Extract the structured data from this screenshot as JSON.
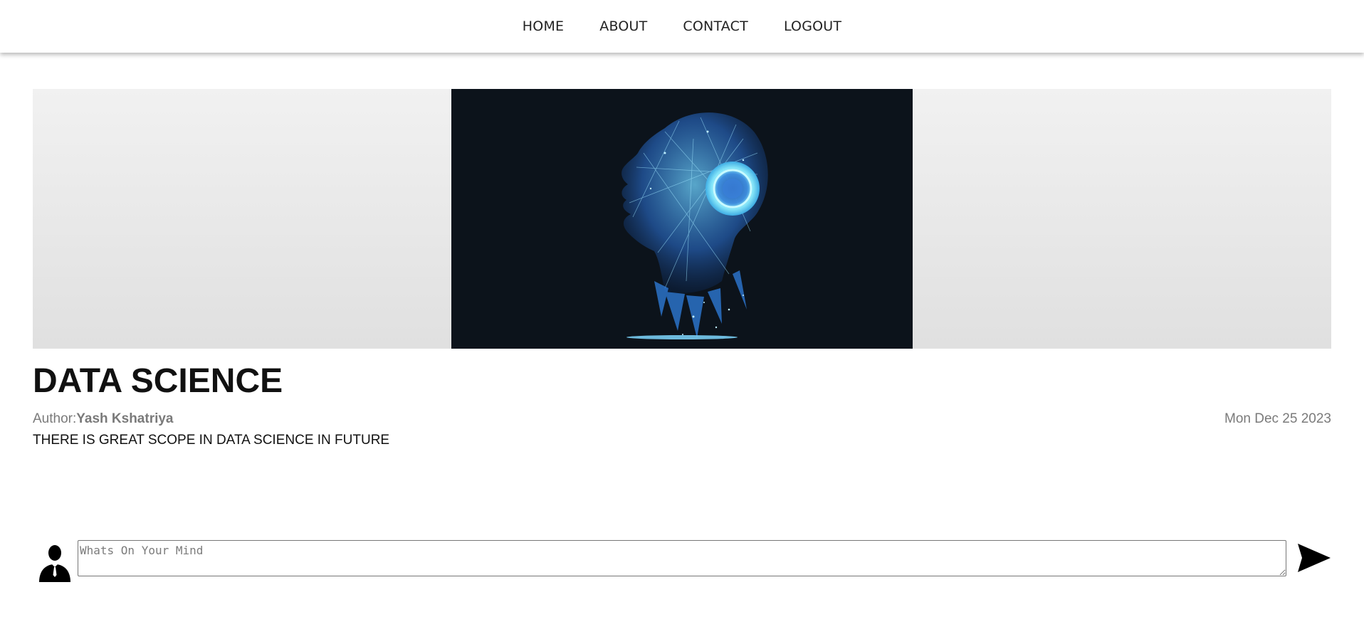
{
  "nav": {
    "items": [
      {
        "label": "HOME"
      },
      {
        "label": "ABOUT"
      },
      {
        "label": "CONTACT"
      },
      {
        "label": "LOGOUT"
      }
    ]
  },
  "post": {
    "title": "DATA SCIENCE",
    "author_label": "Author:",
    "author_name": "Yash Kshatriya",
    "date": "Mon Dec 25 2023",
    "body": "THERE IS GREAT SCOPE IN DATA SCIENCE IN FUTURE",
    "image_icon": "ai-head-illustration"
  },
  "comment": {
    "placeholder": "Whats On Your Mind",
    "avatar_icon": "user-avatar-icon",
    "send_icon": "send-icon"
  },
  "colors": {
    "nav_bg": "#ffffff",
    "hero_bg": "#e8e8e8",
    "image_bg": "#0c131b",
    "image_accent": "#4aa8f0",
    "meta_text": "#7a7a7a"
  }
}
